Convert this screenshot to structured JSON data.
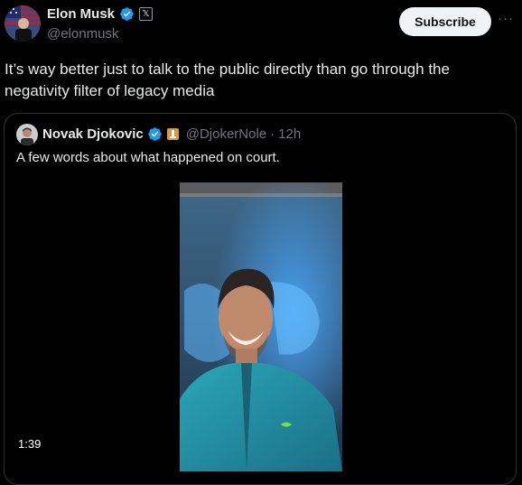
{
  "author": {
    "name": "Elon Musk",
    "handle": "@elonmusk",
    "avatar_icon": "elon-avatar-icon",
    "verified_icon": "verified-badge-icon",
    "affiliation_badge": "𝕏"
  },
  "header": {
    "subscribe_label": "Subscribe",
    "more_label": "···"
  },
  "post": {
    "text": "It’s way better just to talk to the public directly than go through the negativity filter of legacy media"
  },
  "quote": {
    "author_name": "Novak Djokovic",
    "author_handle": "@DjokerNole",
    "separator": "·",
    "time": "12h",
    "verified_icon": "verified-badge-icon",
    "affiliation_icon": "affiliation-badge-icon",
    "text": "A few words about what happened on court.",
    "video_duration": "1:39"
  },
  "colors": {
    "background": "#000000",
    "text": "#e7e9ea",
    "secondary": "#71767b",
    "verified": "#1d9bf0",
    "border": "#2f3336"
  }
}
